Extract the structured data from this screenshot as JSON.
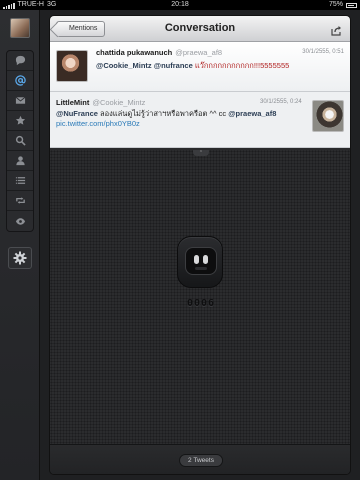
{
  "status_bar": {
    "carrier": "TRUE-H",
    "network": "3G",
    "time": "20:18",
    "battery": "75%"
  },
  "sidebar": {
    "items": [
      {
        "icon": "speech-bubble-icon"
      },
      {
        "icon": "at-sign-icon",
        "active": true
      },
      {
        "icon": "envelope-icon"
      },
      {
        "icon": "star-icon"
      },
      {
        "icon": "search-icon"
      },
      {
        "icon": "profile-icon"
      },
      {
        "icon": "list-icon"
      },
      {
        "icon": "retweet-icon"
      },
      {
        "icon": "eye-icon"
      }
    ],
    "settings_icon": "gear-icon"
  },
  "header": {
    "back_label": "Mentions",
    "title": "Conversation",
    "share_icon": "share-icon"
  },
  "tweets": [
    {
      "name": "chattida pukawanuch",
      "handle": "@praewa_af8",
      "date": "30/1/2555, 0:51",
      "mention1": "@Cookie_Mintz",
      "mention2": "@nufrance",
      "thai_text": "แว๊กกกกกกกกกกก!!!5555555"
    },
    {
      "name": "LittleMint",
      "handle": "@Cookie_Mintz",
      "date": "30/1/2555, 0:24",
      "mention1": "@NuFrance",
      "thai_text": "ลองแล่นดูไม่รู้ว่าสาฯหรือพาครือต ^^ cc",
      "mention2": "@praewa_af8",
      "link": "pic.twitter.com/phx0YB0z"
    }
  ],
  "drawer": {
    "code": "0006",
    "robot_icon": "robot-mascot-icon"
  },
  "footer": {
    "tweet_count": "2 Tweets"
  },
  "colors": {
    "accent": "#5aa7e8",
    "link": "#2a7ab8"
  }
}
